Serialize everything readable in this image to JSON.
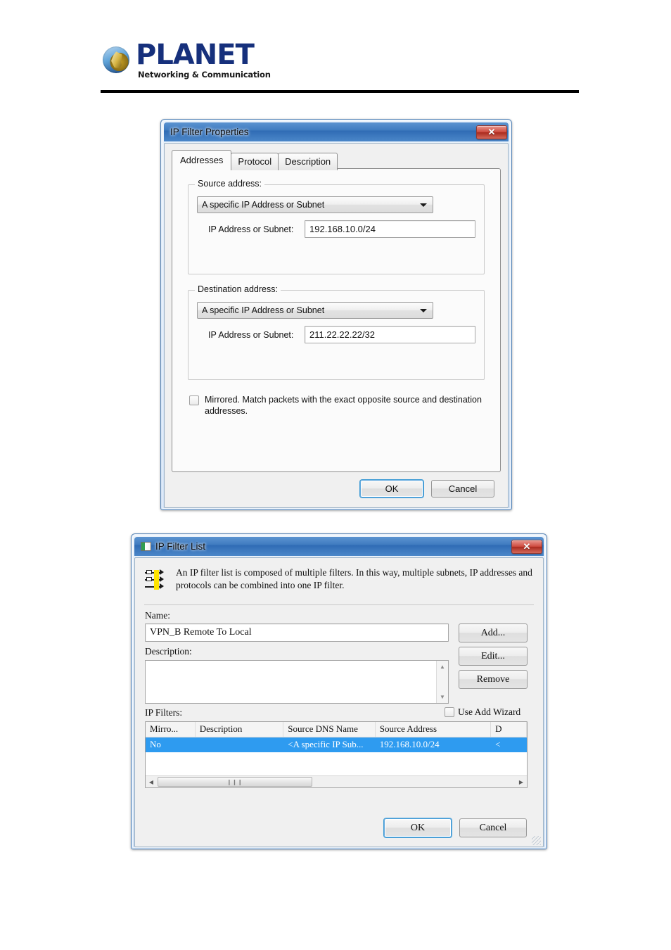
{
  "page": {
    "logo": {
      "name": "PLANET",
      "tagline": "Networking & Communication",
      "icon": "planet-globe-logo"
    }
  },
  "dialog_filter_properties": {
    "title": "IP Filter Properties",
    "close_label": "✕",
    "tabs": [
      {
        "label": "Addresses",
        "active": true
      },
      {
        "label": "Protocol",
        "active": false
      },
      {
        "label": "Description",
        "active": false
      }
    ],
    "source_group": {
      "legend": "Source address:",
      "dropdown_value": "A specific IP Address or Subnet",
      "field_label": "IP Address or Subnet:",
      "field_value": "192.168.10.0/24"
    },
    "destination_group": {
      "legend": "Destination address:",
      "dropdown_value": "A specific IP Address or Subnet",
      "field_label": "IP Address or Subnet:",
      "field_value": "211.22.22.22/32"
    },
    "mirrored": {
      "checked": false,
      "label": "Mirrored. Match packets with the exact opposite source and destination addresses."
    },
    "buttons": {
      "ok": "OK",
      "cancel": "Cancel"
    }
  },
  "dialog_filter_list": {
    "title": "IP Filter List",
    "close_label": "✕",
    "window_icon": "filter-list-icon",
    "info_icon": "ip-filter-list-icon",
    "info_text": "An IP filter list is composed of multiple filters. In this way, multiple subnets, IP addresses and protocols can be combined into one IP filter.",
    "name_label": "Name:",
    "name_value": "VPN_B Remote To Local",
    "description_label": "Description:",
    "description_value": "",
    "ip_filters_label": "IP Filters:",
    "use_add_wizard": {
      "label": "Use Add Wizard",
      "checked": false
    },
    "side_buttons": [
      {
        "label": "Add..."
      },
      {
        "label": "Edit..."
      },
      {
        "label": "Remove"
      }
    ],
    "table": {
      "columns": [
        "Mirro...",
        "Description",
        "Source DNS Name",
        "Source Address",
        "D"
      ],
      "rows": [
        {
          "cells": [
            "No",
            "",
            "<A specific IP Sub...",
            "192.168.10.0/24",
            "<"
          ],
          "selected": true
        }
      ]
    },
    "buttons": {
      "ok": "OK",
      "cancel": "Cancel"
    }
  },
  "colors": {
    "title_blue": "#3f7bc0",
    "selection_blue": "#2e9bf0",
    "close_red": "#cf4b3f",
    "brand_blue": "#16307c",
    "focus_blue": "#3c9ad4",
    "icon_yellow": "#ffe400"
  }
}
